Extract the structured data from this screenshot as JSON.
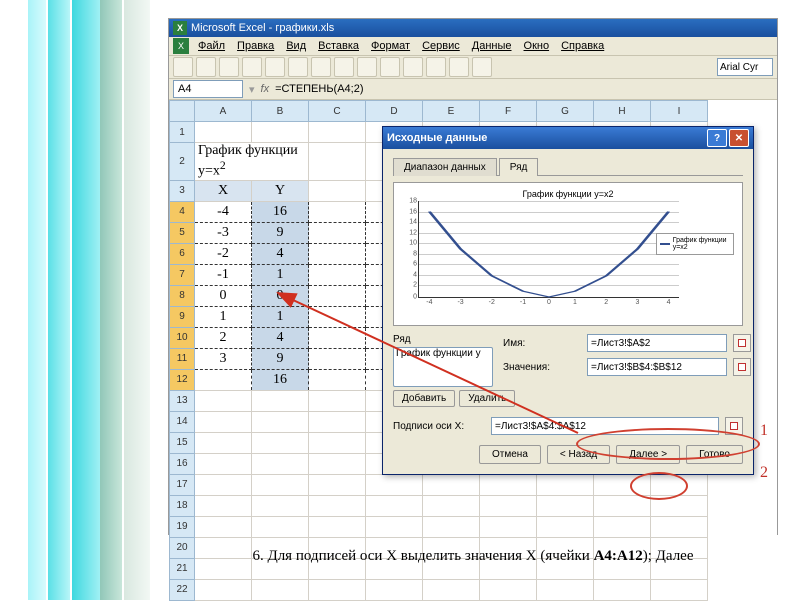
{
  "title": "Microsoft Excel - графики.xls",
  "menu": [
    "Файл",
    "Правка",
    "Вид",
    "Вставка",
    "Формат",
    "Сервис",
    "Данные",
    "Окно",
    "Справка"
  ],
  "font_box": "Arial Cyr",
  "namebox": "A4",
  "formula": "=СТЕПЕНЬ(A4;2)",
  "cols": [
    "A",
    "B",
    "C",
    "D",
    "E",
    "F",
    "G",
    "H",
    "I"
  ],
  "sheet_title": "График  функции  y=x",
  "sheet_title_sup": "2",
  "hx": "X",
  "hy": "Y",
  "rows": [
    {
      "r": "4",
      "x": "-4",
      "y": "16"
    },
    {
      "r": "5",
      "x": "-3",
      "y": "9"
    },
    {
      "r": "6",
      "x": "-2",
      "y": "4"
    },
    {
      "r": "7",
      "x": "-1",
      "y": "1"
    },
    {
      "r": "8",
      "x": "0",
      "y": "0"
    },
    {
      "r": "9",
      "x": "1",
      "y": "1"
    },
    {
      "r": "10",
      "x": "2",
      "y": "4"
    },
    {
      "r": "11",
      "x": "3",
      "y": "9"
    },
    {
      "r": "12",
      "x": "",
      "y": "16"
    }
  ],
  "dialog": {
    "title": "Исходные данные",
    "tabs": [
      "Диапазон данных",
      "Ряд"
    ],
    "chart_title": "График  функции y=x2",
    "legend": "График  функции y=x2",
    "series_label": "Ряд",
    "series_item": "График  функции y",
    "name_label": "Имя:",
    "name_val": "=Лист3!$A$2",
    "values_label": "Значения:",
    "values_val": "=Лист3!$B$4:$B$12",
    "xlabels_label": "Подписи оси X:",
    "xlabels_val": "=Лист3!$A$4:$A$12",
    "add": "Добавить",
    "del": "Удалить",
    "btns": [
      "Отмена",
      "< Назад",
      "Далее >",
      "Готово"
    ]
  },
  "annotations": {
    "a1": "1",
    "a2": "2"
  },
  "caption_pre": "6. Для подписей оси Х выделить значения Х (ячейки ",
  "caption_bold": "А4:А12",
  "caption_post": "); Далее",
  "chart_data": {
    "type": "line",
    "title": "График функции y=x2",
    "x": [
      -4,
      -3,
      -2,
      -1,
      0,
      1,
      2,
      3,
      4
    ],
    "values": [
      16,
      9,
      4,
      1,
      0,
      1,
      4,
      9,
      16
    ],
    "series": [
      {
        "name": "График функции y=x2",
        "values": [
          16,
          9,
          4,
          1,
          0,
          1,
          4,
          9,
          16
        ]
      }
    ],
    "xlabel": "",
    "ylabel": "",
    "ylim": [
      0,
      18
    ],
    "xlim": [
      -4,
      4
    ]
  }
}
